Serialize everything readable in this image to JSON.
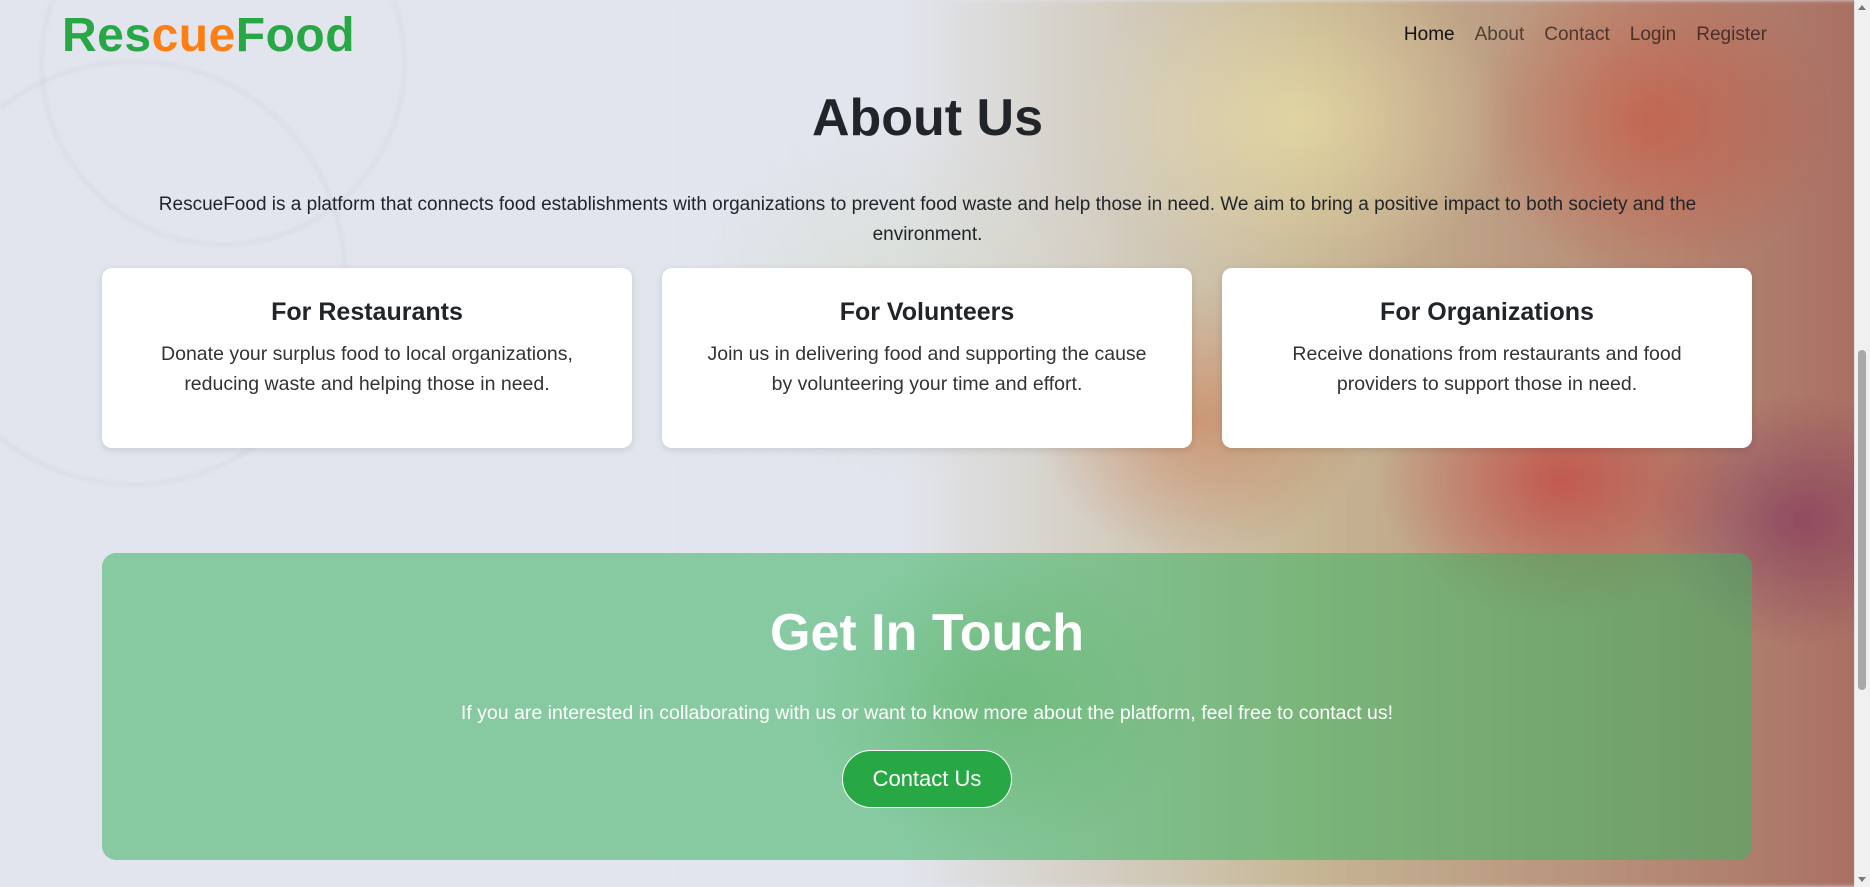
{
  "brand": {
    "part1": "Res",
    "part2": "cue",
    "part3": "Food"
  },
  "nav": {
    "home": "Home",
    "about": "About",
    "contact": "Contact",
    "login": "Login",
    "register": "Register"
  },
  "about": {
    "title": "About Us",
    "description": "RescueFood is a platform that connects food establishments with organizations to prevent food waste and help those in need. We aim to bring a positive impact to both society and the environment."
  },
  "cards": [
    {
      "title": "For Restaurants",
      "text": "Donate your surplus food to local organizations, reducing waste and helping those in need."
    },
    {
      "title": "For Volunteers",
      "text": "Join us in delivering food and supporting the cause by volunteering your time and effort."
    },
    {
      "title": "For Organizations",
      "text": "Receive donations from restaurants and food providers to support those in need."
    }
  ],
  "touch": {
    "title": "Get In Touch",
    "text": "If you are interested in collaborating with us or want to know more about the platform, feel free to contact us!",
    "button": "Contact Us"
  },
  "colors": {
    "brand_green": "#28a745",
    "brand_orange": "#fd7e14"
  }
}
